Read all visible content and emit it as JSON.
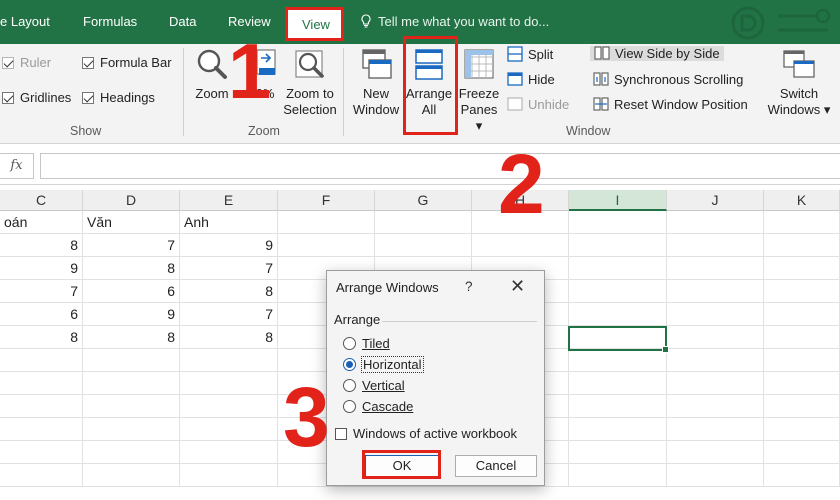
{
  "tabs": [
    {
      "label": "e Layout",
      "active": false
    },
    {
      "label": "Formulas",
      "active": false
    },
    {
      "label": "Data",
      "active": false
    },
    {
      "label": "Review",
      "active": false
    },
    {
      "label": "View",
      "active": true
    }
  ],
  "tell_me": "Tell me what you want to do...",
  "ribbon": {
    "show": {
      "ruler": "Ruler",
      "formula_bar": "Formula Bar",
      "gridlines": "Gridlines",
      "headings": "Headings",
      "label": "Show"
    },
    "zoom": {
      "zoom": "Zoom",
      "hundred": "0%",
      "zoom_to_line1": "Zoom to",
      "zoom_to_line2": "Selection",
      "label": "Zoom"
    },
    "window": {
      "new_line1": "New",
      "new_line2": "Window",
      "arrange_line1": "Arrange",
      "arrange_line2": "All",
      "freeze_line1": "Freeze",
      "freeze_line2": "Panes ▾",
      "split": "Split",
      "hide": "Hide",
      "unhide": "Unhide",
      "view_side": "View Side by Side",
      "sync_scroll": "Synchronous Scrolling",
      "reset_pos": "Reset Window Position",
      "switch_line1": "Switch",
      "switch_line2": "Windows ▾",
      "label": "Window"
    }
  },
  "formula_bar": {
    "fx": "fx",
    "value": ""
  },
  "columns": [
    "C",
    "D",
    "E",
    "F",
    "G",
    "H",
    "I",
    "J",
    "K"
  ],
  "selected_column": "I",
  "rows": [
    [
      "oán",
      "Văn",
      "Anh"
    ],
    [
      "8",
      "7",
      "9"
    ],
    [
      "9",
      "8",
      "7"
    ],
    [
      "7",
      "6",
      "8"
    ],
    [
      "6",
      "9",
      "7"
    ],
    [
      "8",
      "8",
      "8"
    ]
  ],
  "dialog": {
    "title": "Arrange Windows",
    "help": "?",
    "close": "✕",
    "group": "Arrange",
    "options": [
      "Tiled",
      "Horizontal",
      "Vertical",
      "Cascade"
    ],
    "selected": "Horizontal",
    "checkbox": "Windows of active workbook",
    "ok": "OK",
    "cancel": "Cancel"
  },
  "steps": [
    "1",
    "2",
    "3"
  ],
  "colors": {
    "excel_green": "#217346",
    "annotation_red": "#e2231a",
    "radio_blue": "#1b5fb5"
  }
}
